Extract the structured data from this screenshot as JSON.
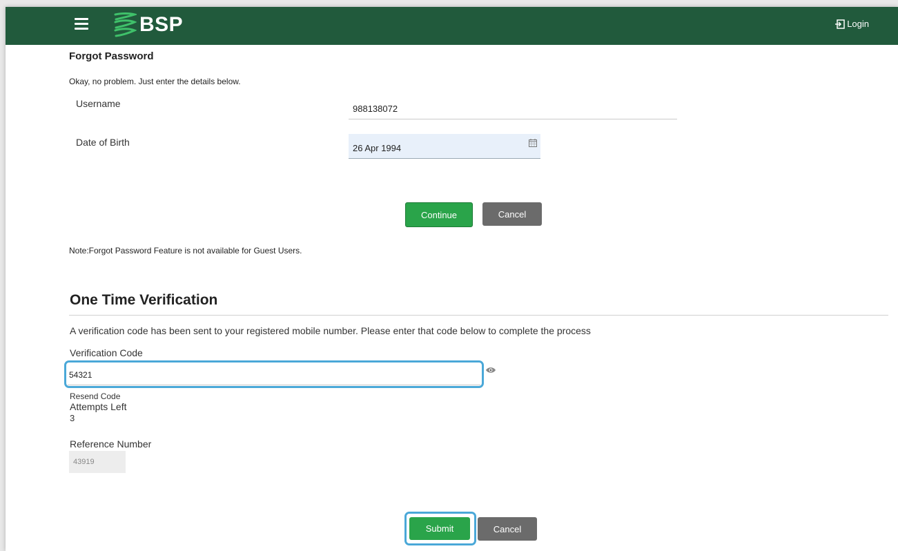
{
  "header": {
    "menu_icon": "hamburger-icon",
    "brand": "BSP",
    "login_label": "Login",
    "login_icon": "login-icon",
    "bg_color": "#215a3c"
  },
  "forgot": {
    "title": "Forgot Password",
    "subtitle": "Okay, no problem. Just enter the details below.",
    "username_label": "Username",
    "username_value": "988138072",
    "dob_label": "Date of Birth",
    "dob_value": "26 Apr 1994",
    "calendar_icon": "calendar-icon",
    "continue_label": "Continue",
    "cancel_label": "Cancel",
    "note": "Note:Forgot Password Feature is not available for Guest Users."
  },
  "otv": {
    "title": "One Time Verification",
    "description": "A verification code has been sent to your registered mobile number. Please enter that code below to complete the process",
    "code_label": "Verification Code",
    "code_value": "54321",
    "eye_icon": "eye-icon",
    "resend_label": "Resend Code",
    "attempts_label": "Attempts Left",
    "attempts_value": "3",
    "reference_label": "Reference Number",
    "reference_value": "43919",
    "submit_label": "Submit",
    "cancel_label": "Cancel",
    "accent_color": "#2aa44a",
    "highlight_color": "#4aa8d8"
  }
}
